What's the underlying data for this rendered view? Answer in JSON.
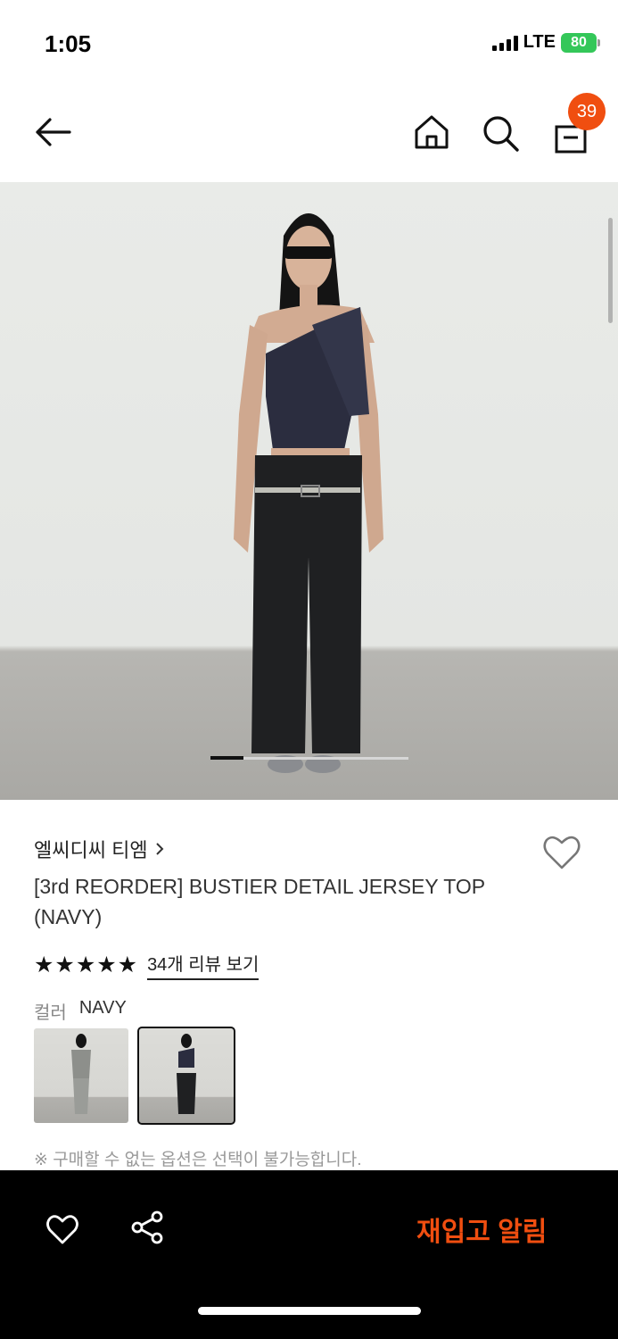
{
  "status": {
    "time": "1:05",
    "network": "LTE",
    "battery": "80"
  },
  "header": {
    "cart_count": "39"
  },
  "product": {
    "brand": "엘씨디씨 티엠",
    "title": "[3rd REORDER] BUSTIER DETAIL JERSEY TOP (NAVY)",
    "stars": "★★★★★",
    "rating": 5,
    "review_link": "34개 리뷰 보기",
    "color_label": "컬러",
    "color_value": "NAVY",
    "notice": "※ 구매할 수 없는 옵션은 선택이 불가능합니다."
  },
  "carousel": {
    "current": 1,
    "total": 6
  },
  "bottom": {
    "restock_label": "재입고 알림"
  },
  "colors": {
    "accent": "#f04e10",
    "star": "#111111",
    "battery": "#34c759"
  },
  "icons": [
    "back-arrow-icon",
    "home-icon",
    "search-icon",
    "shopping-bag-icon",
    "heart-icon",
    "share-icon"
  ]
}
